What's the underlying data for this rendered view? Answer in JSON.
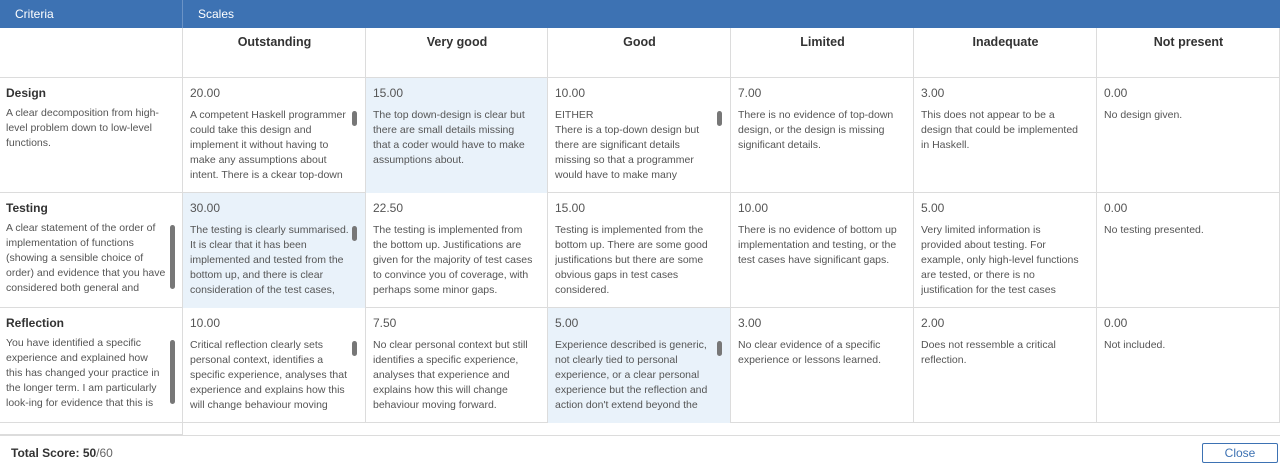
{
  "header": {
    "criteria_label": "Criteria",
    "scales_label": "Scales"
  },
  "scales": [
    "Outstanding",
    "Very good",
    "Good",
    "Limited",
    "Inadequate",
    "Not present"
  ],
  "criteria": [
    {
      "title": "Design",
      "description": "A clear decomposition from high-level problem down to low-level functions.",
      "selected_index": 1,
      "levels": [
        {
          "score": "20.00",
          "text": "A competent Haskell programmer could take this design and implement it without having to make any assumptions about intent. There is a ckear top-down structure"
        },
        {
          "score": "15.00",
          "text": "The top down-design is clear but there are small details missing that a coder would have to make assumptions about."
        },
        {
          "score": "10.00",
          "text": "EITHER\nThere is a top-down design but there are significant details missing so that a programmer would have to make many assumptions to"
        },
        {
          "score": "7.00",
          "text": "There is no evidence of top-down design, or the design is missing significant details."
        },
        {
          "score": "3.00",
          "text": "This does not appear to be a design that could be implemented in Haskell."
        },
        {
          "score": "0.00",
          "text": "No design given."
        }
      ]
    },
    {
      "title": "Testing",
      "description": "A clear statement of the order of implementation of functions (showing a sensible choice of order) and evidence that you have considered both general and special",
      "selected_index": 0,
      "levels": [
        {
          "score": "30.00",
          "text": "The testing is clearly summarised. It is clear that it has been implemented and tested from the bottom up, and there is clear consideration of the test cases, with"
        },
        {
          "score": "22.50",
          "text": "The testing is implemented from the bottom up. Justifications are given for the majority of test cases to convince you of coverage, with perhaps some minor gaps."
        },
        {
          "score": "15.00",
          "text": "Testing is implemented from the bottom up. There are some good justifications but there are some obvious gaps in test cases considered."
        },
        {
          "score": "10.00",
          "text": "There is no evidence of bottom up implementation and testing, or the test cases have significant gaps."
        },
        {
          "score": "5.00",
          "text": "Very limited information is provided about testing. For example, only high-level functions are tested, or there is no justification for the test cases used."
        },
        {
          "score": "0.00",
          "text": "No testing presented."
        }
      ]
    },
    {
      "title": "Reflection",
      "description": "You have identified a specific experience and explained how this has changed your practice in the longer term. I am particularly look-ing for evidence that this is",
      "selected_index": 2,
      "levels": [
        {
          "score": "10.00",
          "text": "Critical reflection clearly sets personal context, identifies a specific experience, analyses that experience and explains how this will change behaviour moving"
        },
        {
          "score": "7.50",
          "text": "No clear personal context but still identifies a specific experience, analyses that experience and explains how this will change behaviour moving forward."
        },
        {
          "score": "5.00",
          "text": "Experience described is generic, not clearly tied to personal experience, or a clear personal experience but the reflection and action don't extend beyond the specific"
        },
        {
          "score": "3.00",
          "text": "No clear evidence of a specific experience or lessons learned."
        },
        {
          "score": "2.00",
          "text": "Does not ressemble a critical reflection."
        },
        {
          "score": "0.00",
          "text": "Not included."
        }
      ]
    }
  ],
  "footer": {
    "total_label": "Total Score:",
    "total_value": "50",
    "total_max": "/60",
    "close_label": "Close"
  }
}
